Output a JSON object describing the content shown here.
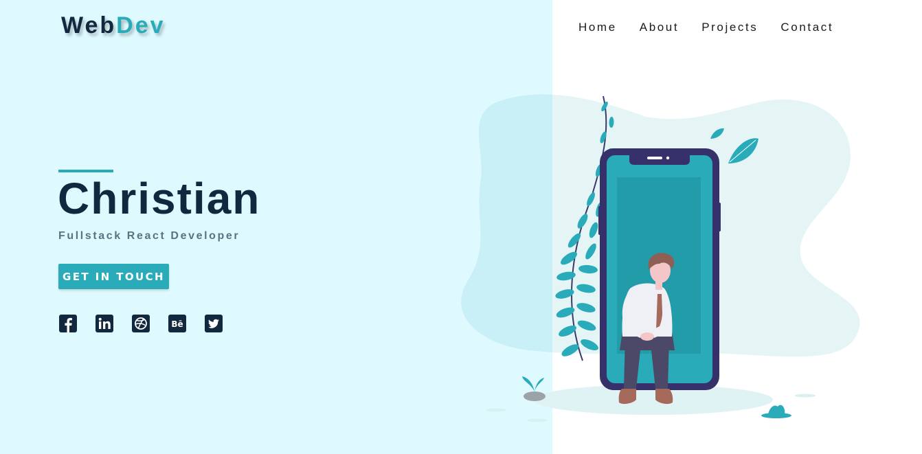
{
  "logo": {
    "part1": "Web",
    "part2": "Dev"
  },
  "nav": {
    "home": "Home",
    "about": "About",
    "projects": "Projects",
    "contact": "Contact"
  },
  "hero": {
    "name": "Christian",
    "role": "Fullstack React Developer",
    "cta": "GET IN TOUCH"
  },
  "socials": {
    "facebook": "facebook-icon",
    "linkedin": "linkedin-icon",
    "dribbble": "dribbble-icon",
    "behance": "behance-icon",
    "twitter": "twitter-icon"
  },
  "colors": {
    "accent": "#2aabb9",
    "dark": "#12283f",
    "left_bg": "#dffaff"
  }
}
